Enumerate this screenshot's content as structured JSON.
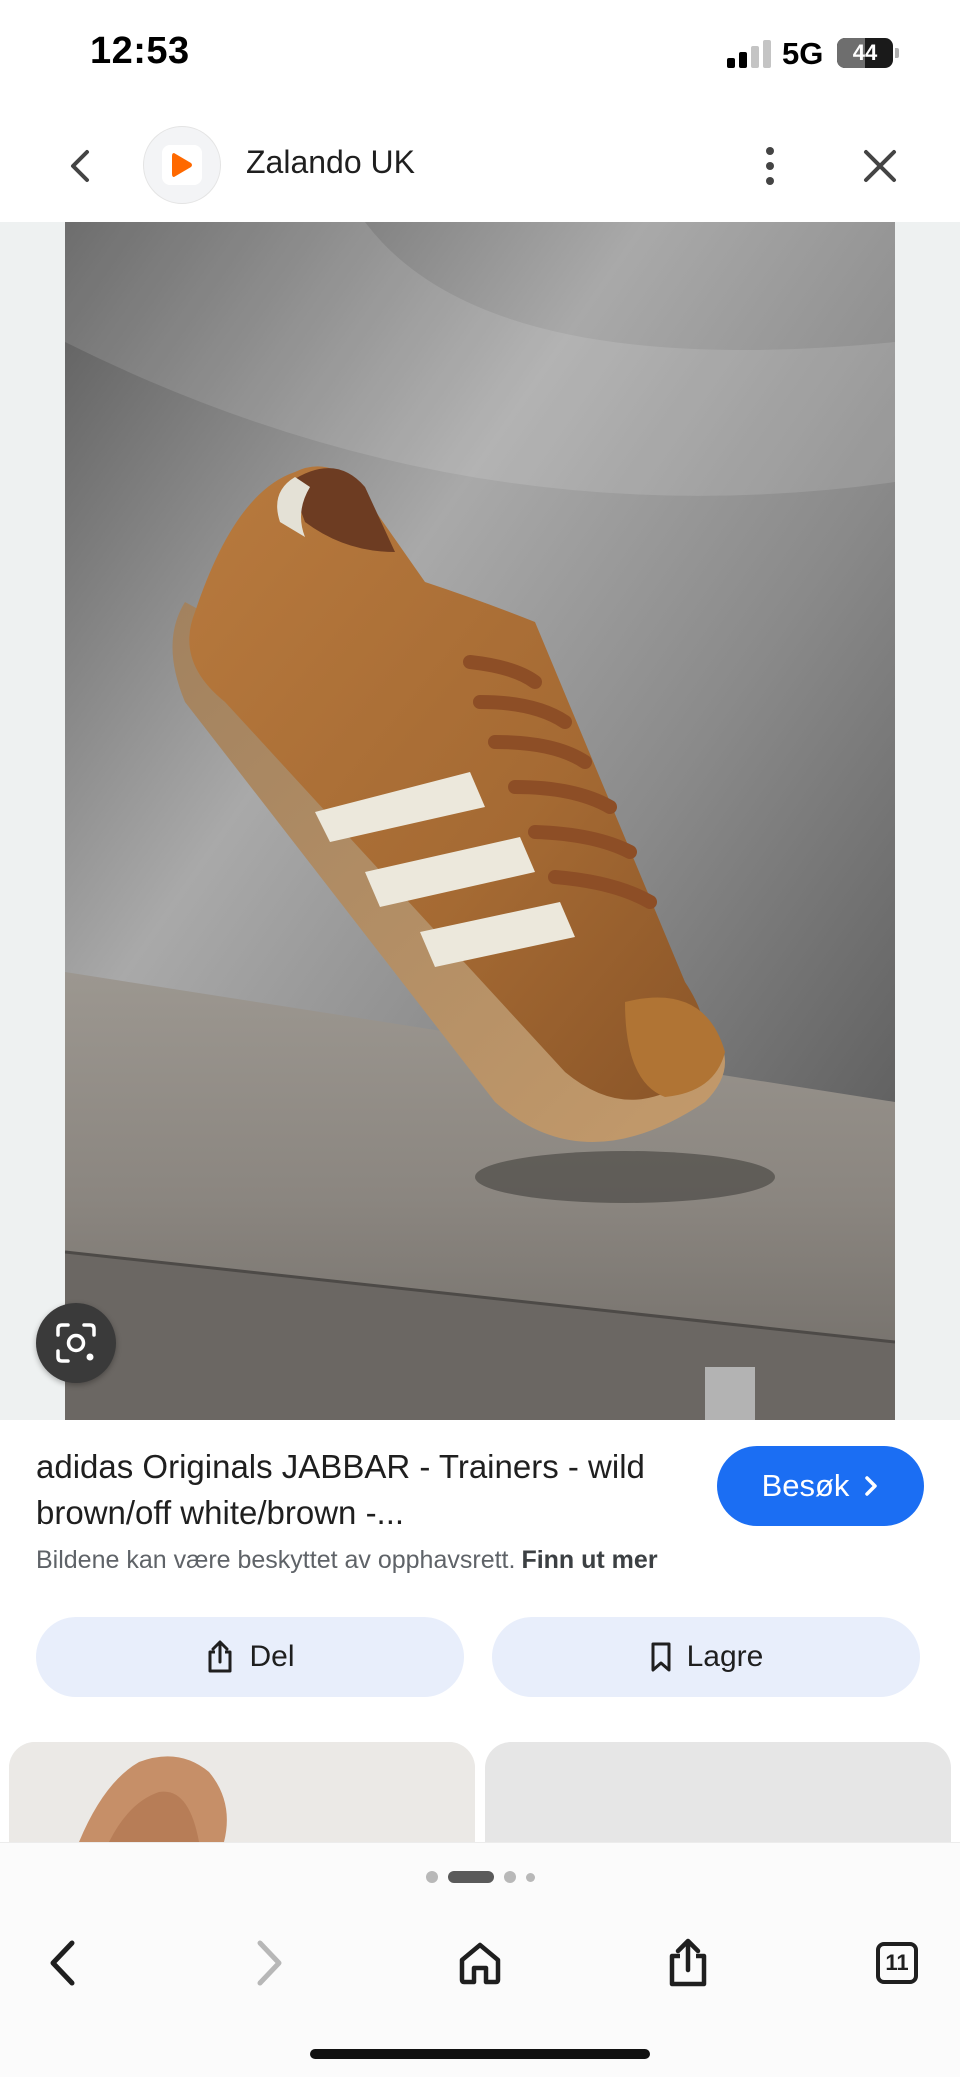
{
  "status_bar": {
    "time": "12:53",
    "network": "5G",
    "battery": "44"
  },
  "header": {
    "site_name": "Zalando UK"
  },
  "product": {
    "title": "adidas Originals JABBAR - Trainers - wild brown/off white/brown -...",
    "visit_label": "Besøk",
    "copyright_text": "Bildene kan være beskyttet av opphavsrett.",
    "learn_more_label": "Finn ut mer"
  },
  "actions": {
    "share_label": "Del",
    "save_label": "Lagre"
  },
  "toolbar": {
    "tab_count": "11"
  },
  "colors": {
    "accent": "#1b6ef3",
    "action_bg": "#e8eefb",
    "logo_orange": "#ff6900"
  }
}
